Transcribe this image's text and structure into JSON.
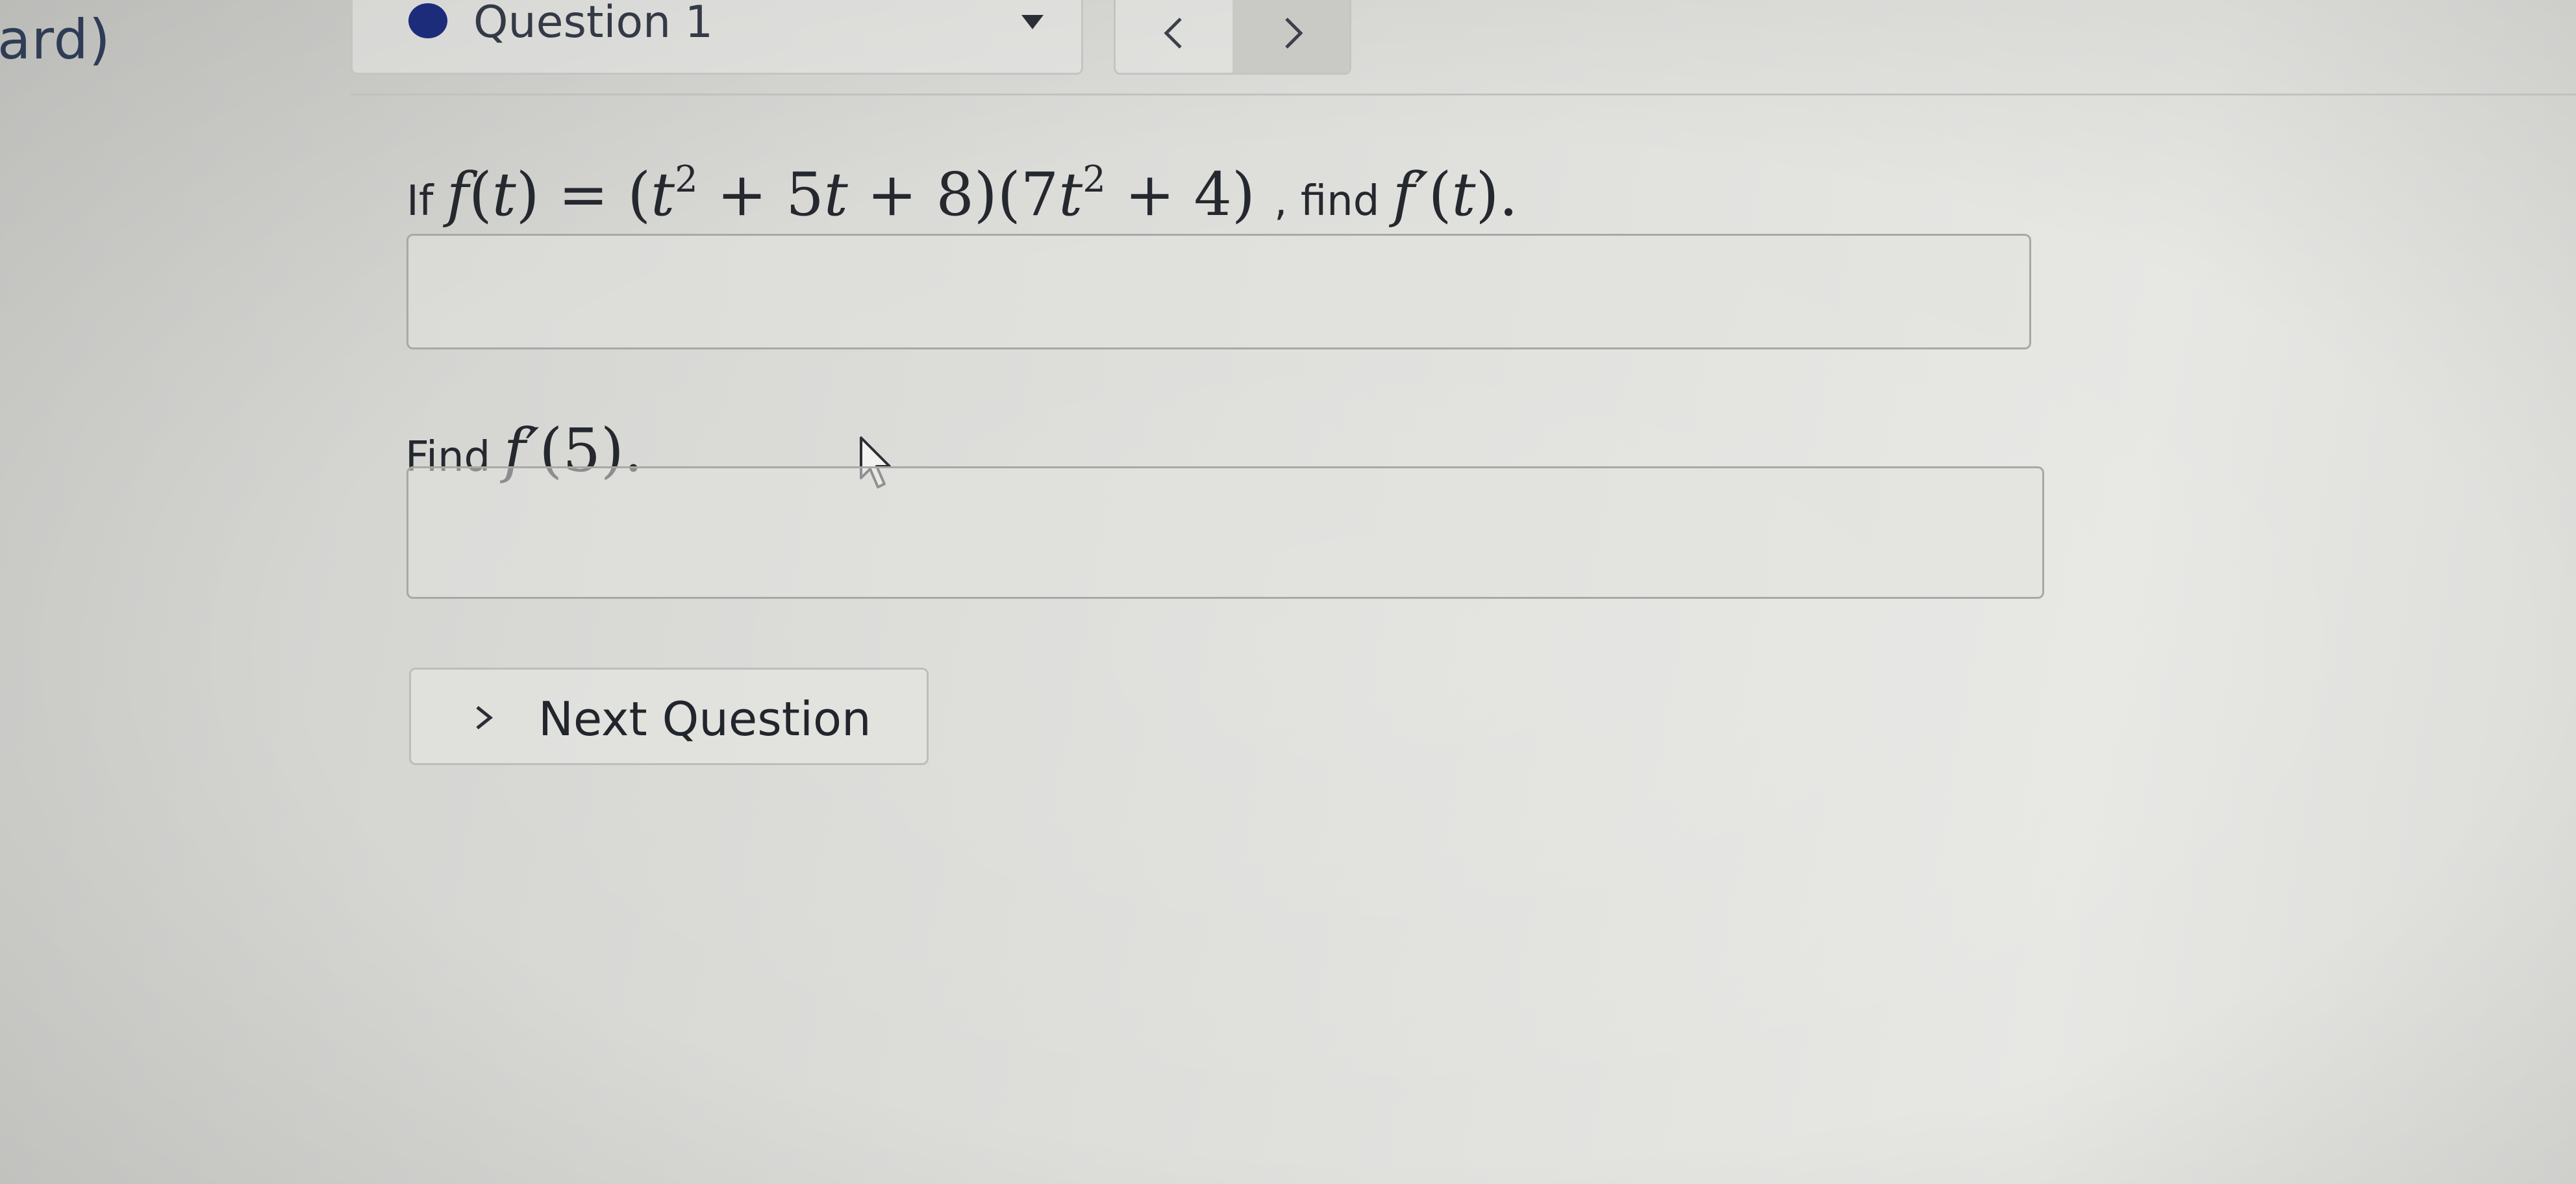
{
  "left_fragment": "ard)",
  "question_selector": {
    "label": "Question 1",
    "status_color": "#1c2c7a"
  },
  "nav": {
    "prev_icon": "chevron-left-icon",
    "next_icon": "chevron-right-icon"
  },
  "problem": {
    "prefix": "If",
    "f": "f",
    "paren_open": "(",
    "t": "t",
    "paren_close": ")",
    "equals": "=",
    "factor1_open": "(",
    "factor1_t": "t",
    "exp": "2",
    "factor1_rest": " + 5",
    "factor1_t2": "t",
    "factor1_tail": " + 8)",
    "factor2_open": "(7",
    "factor2_t": "t",
    "factor2_exp": "2",
    "factor2_tail": " + 4)",
    "comma_find": ", find",
    "fprime": "f′",
    "arg_open": "(",
    "arg_t": "t",
    "arg_close": ").",
    "answer_value": ""
  },
  "part2": {
    "prefix": "Find",
    "fprime": "f′",
    "arg": "(5).",
    "answer_value": ""
  },
  "next_button": {
    "label": "Next Question",
    "icon": "chevron-right-icon"
  }
}
